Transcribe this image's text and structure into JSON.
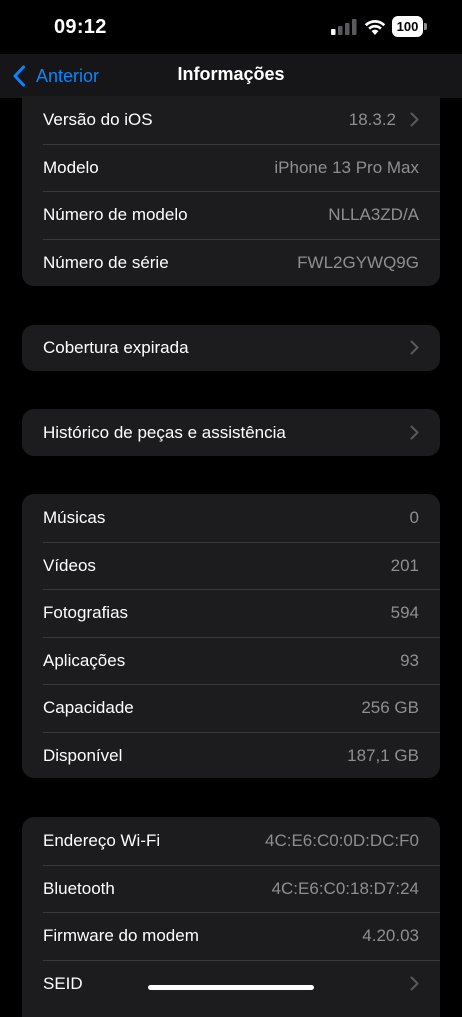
{
  "status_bar": {
    "time": "09:12",
    "battery_level": "100",
    "signal_icon": "cellular-signal-icon",
    "wifi_icon": "wifi-icon"
  },
  "nav": {
    "back_label": "Anterior",
    "title": "Informações"
  },
  "colors": {
    "accent": "#0a84ff",
    "background": "#000000",
    "group_bg": "#1c1c1e",
    "secondary_text": "#8e8e93"
  },
  "device_info": [
    {
      "label": "Versão do iOS",
      "value": "18.3.2",
      "chevron": true
    },
    {
      "label": "Modelo",
      "value": "iPhone 13 Pro Max",
      "chevron": false
    },
    {
      "label": "Número de modelo",
      "value": "NLLA3ZD/A",
      "chevron": false
    },
    {
      "label": "Número de série",
      "value": "FWL2GYWQ9G",
      "chevron": false
    }
  ],
  "coverage": {
    "label": "Cobertura expirada"
  },
  "history": {
    "label": "Histórico de peças e assistência"
  },
  "storage": [
    {
      "label": "Músicas",
      "value": "0"
    },
    {
      "label": "Vídeos",
      "value": "201"
    },
    {
      "label": "Fotografias",
      "value": "594"
    },
    {
      "label": "Aplicações",
      "value": "93"
    },
    {
      "label": "Capacidade",
      "value": "256 GB"
    },
    {
      "label": "Disponível",
      "value": "187,1 GB"
    }
  ],
  "network": [
    {
      "label": "Endereço Wi-Fi",
      "value": "4C:E6:C0:0D:DC:F0"
    },
    {
      "label": "Bluetooth",
      "value": "4C:E6:C0:18:D7:24"
    },
    {
      "label": "Firmware do modem",
      "value": "4.20.03"
    },
    {
      "label": "SEID",
      "value": ""
    }
  ]
}
